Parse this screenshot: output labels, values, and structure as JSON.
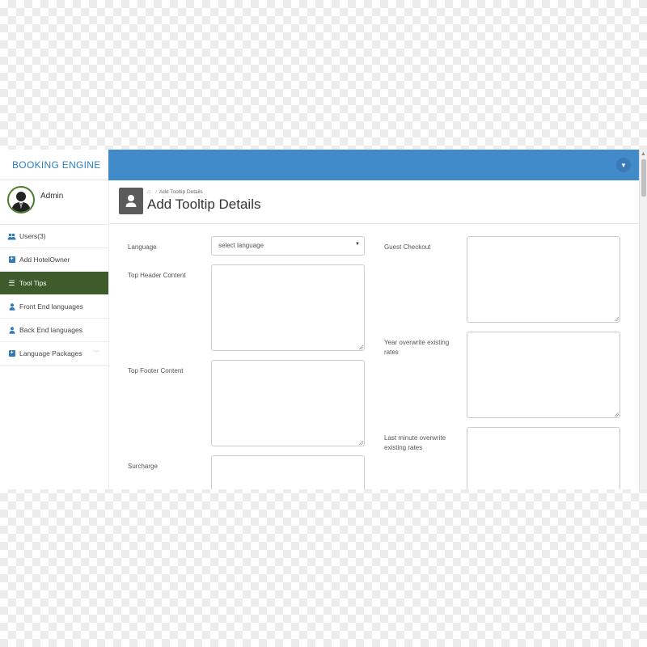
{
  "brand": {
    "logo_bold": "BOOKING",
    "logo_thin": " ENGINE"
  },
  "header": {
    "user_dropdown_icon": "caret-down-icon"
  },
  "sidebar": {
    "profile": {
      "name": "Admin"
    },
    "items": [
      {
        "label": "Users(3)",
        "icon": "users-icon"
      },
      {
        "label": "Add HotelOwner",
        "icon": "plus-square-icon"
      },
      {
        "label": "Tool Tips",
        "icon": "bars-icon",
        "active": true
      },
      {
        "label": "Front End languages",
        "icon": "user-icon"
      },
      {
        "label": "Back End languages",
        "icon": "user-icon"
      },
      {
        "label": "Language Packages",
        "icon": "plus-square-icon",
        "has_chevron": true
      }
    ]
  },
  "page": {
    "breadcrumb": "Add Tooltip Details",
    "title": "Add Tooltip Details"
  },
  "form": {
    "language_label": "Language",
    "language_value": "select language",
    "top_header_label": "Top Header Content",
    "top_footer_label": "Top Footer Content",
    "surcharge_label": "Surcharge",
    "guest_checkout_label": "Guest Checkout",
    "year_overwrite_label": "Year overwrite existing rates",
    "last_minute_label": "Last minute overwrite existing rates"
  },
  "colors": {
    "topbar": "#428bca",
    "active_nav": "#3e5b2b",
    "logo": "#2f7fc1"
  }
}
